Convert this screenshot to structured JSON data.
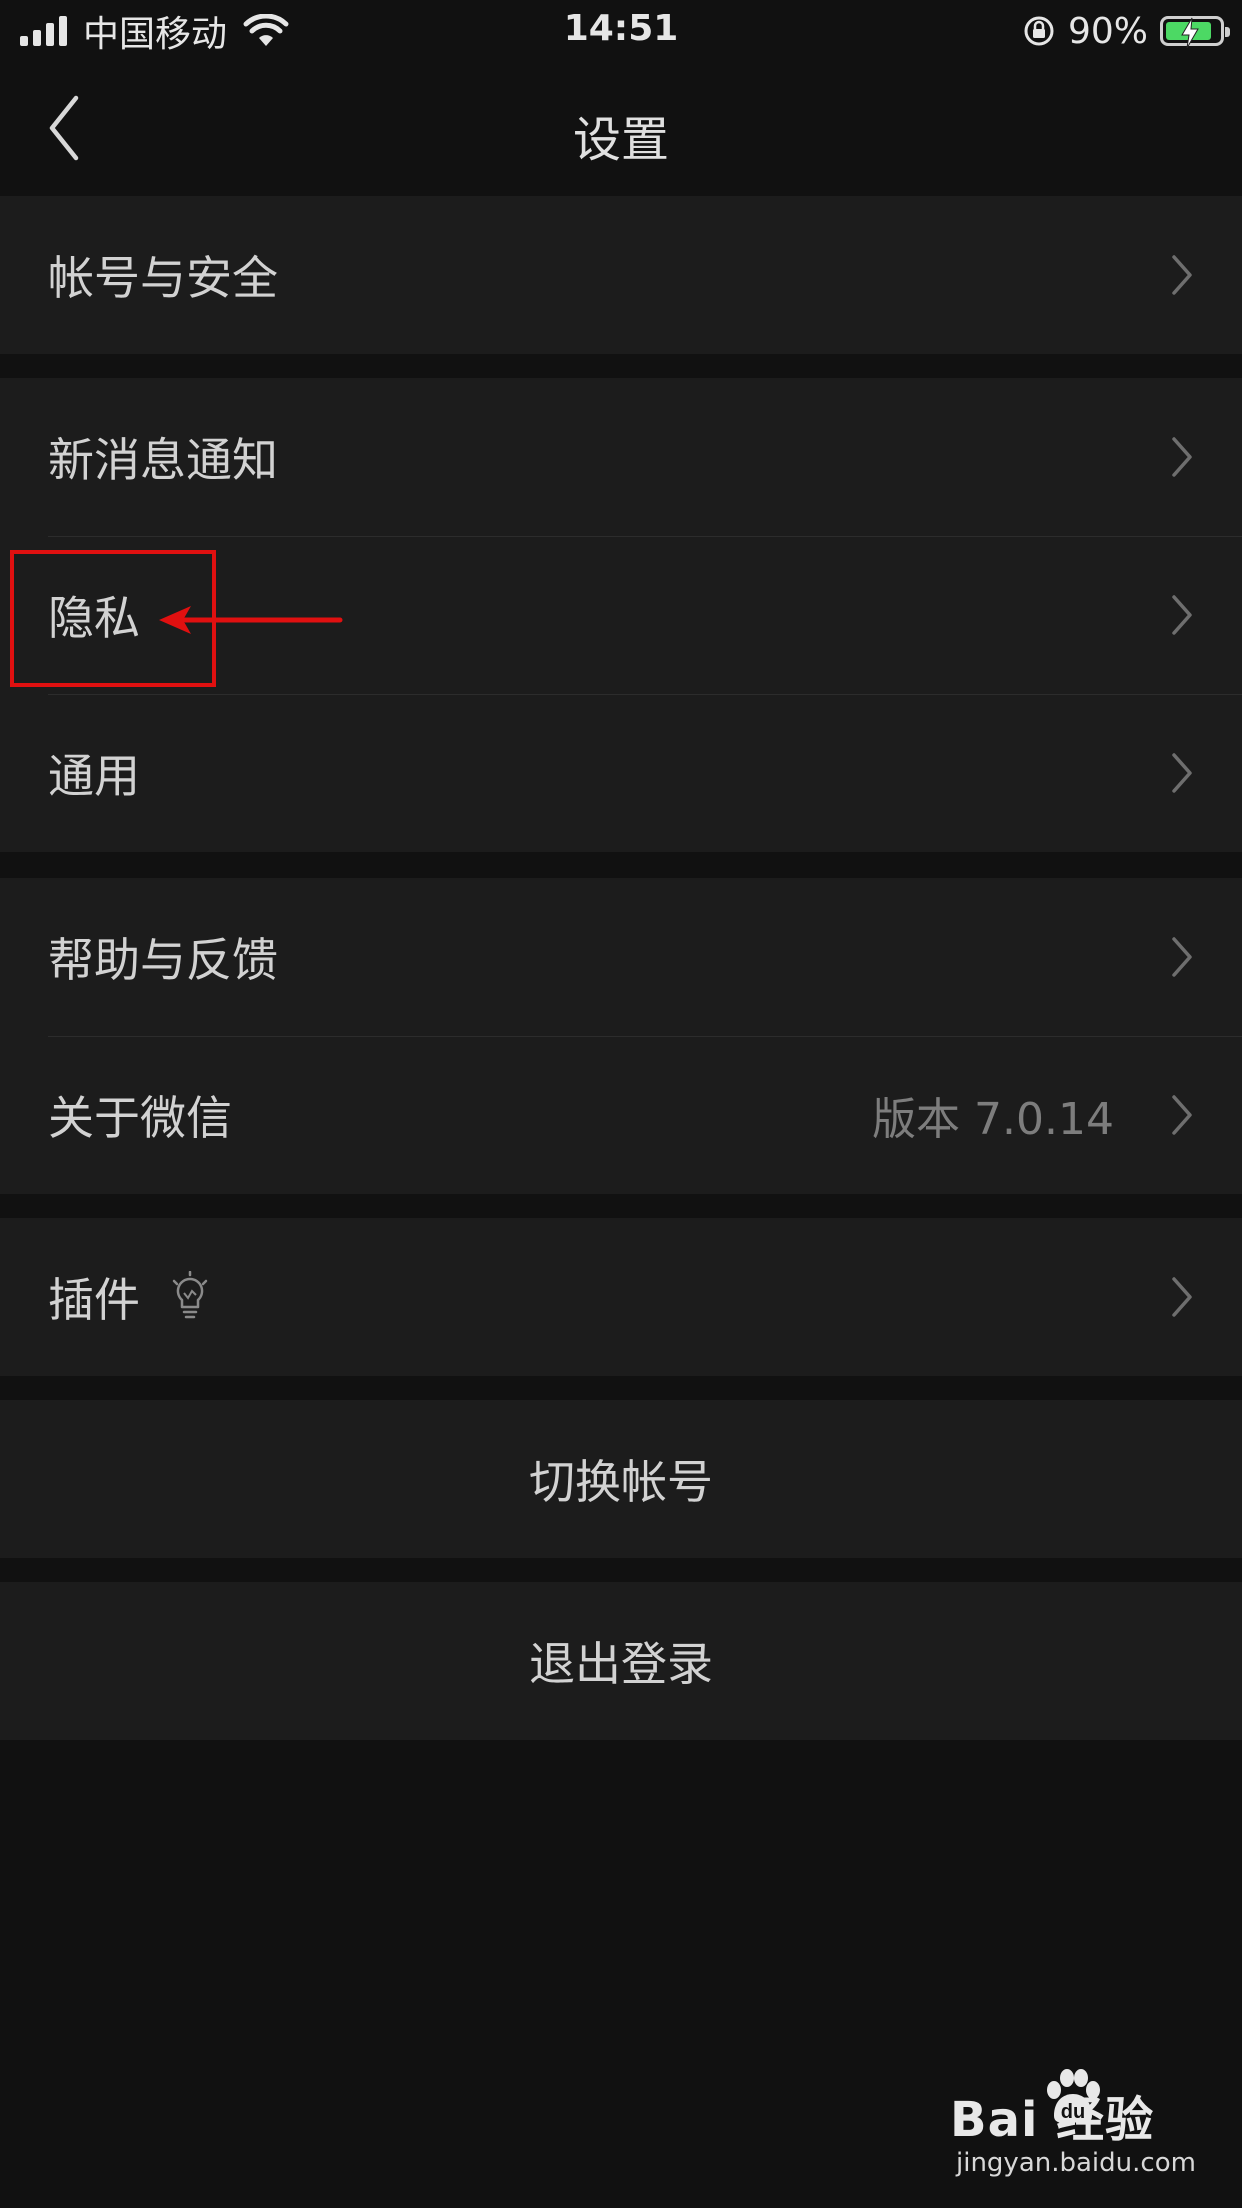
{
  "status_bar": {
    "carrier": "中国移动",
    "time": "14:51",
    "battery_percent": "90%",
    "signal_bars": 4,
    "battery_level": 0.9,
    "battery_color": "#4cd964"
  },
  "nav": {
    "title": "设置",
    "back_icon": "chevron-left-icon"
  },
  "groups": {
    "account": {
      "label": "帐号与安全"
    },
    "notify": {
      "label": "新消息通知"
    },
    "privacy": {
      "label": "隐私"
    },
    "general": {
      "label": "通用"
    },
    "help": {
      "label": "帮助与反馈"
    },
    "about": {
      "label": "关于微信",
      "value": "版本 7.0.14"
    },
    "plugins": {
      "label": "插件",
      "icon": "lightbulb-icon"
    },
    "switch_account": {
      "label": "切换帐号"
    },
    "logout": {
      "label": "退出登录"
    }
  },
  "annotation": {
    "highlight_color": "#e01010",
    "target": "隐私"
  },
  "watermark": {
    "brand": "Bai 经验",
    "url": "jingyan.baidu.com"
  }
}
